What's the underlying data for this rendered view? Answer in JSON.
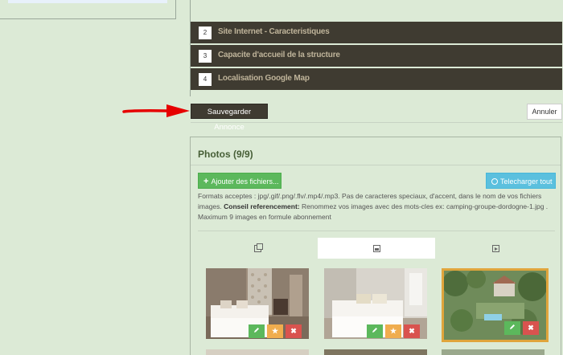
{
  "accordion": [
    {
      "num": "2",
      "label": "Site Internet - Caracteristiques"
    },
    {
      "num": "3",
      "label": "Capacite d'accueil de la structure"
    },
    {
      "num": "4",
      "label": "Localisation Google Map"
    }
  ],
  "actions": {
    "save_label": "Sauvegarder Annonce",
    "cancel_label": "Annuler"
  },
  "photos": {
    "title": "Photos (9/9)",
    "add_label": "Ajouter des fichiers...",
    "download_label": "Telecharger tout",
    "info_formats": "Formats acceptes : jpg/.gif/.png/.flv/.mp4/.mp3. Pas de caracteres speciaux, d'accent, dans le nom de vos fichiers images.",
    "info_tip_label": "Conseil referencement:",
    "info_tip": "Renommez vos images avec des mots-cles ex: camping-groupe-dordogne-1.jpg . Maximum 9 images en formule abonnement",
    "tabs": [
      {
        "icon": "copy-icon",
        "active": false
      },
      {
        "icon": "image-icon",
        "active": true
      },
      {
        "icon": "video-icon",
        "active": false
      }
    ]
  },
  "colors": {
    "background": "#dcead6",
    "accordion_bg": "#3f3b31",
    "accordion_text": "#bfb49a",
    "success": "#5cb85c",
    "info": "#5bc0de",
    "warning": "#f0ad4e",
    "danger": "#d9534f",
    "selected_border": "#e0a53c",
    "arrow": "#e60000"
  }
}
